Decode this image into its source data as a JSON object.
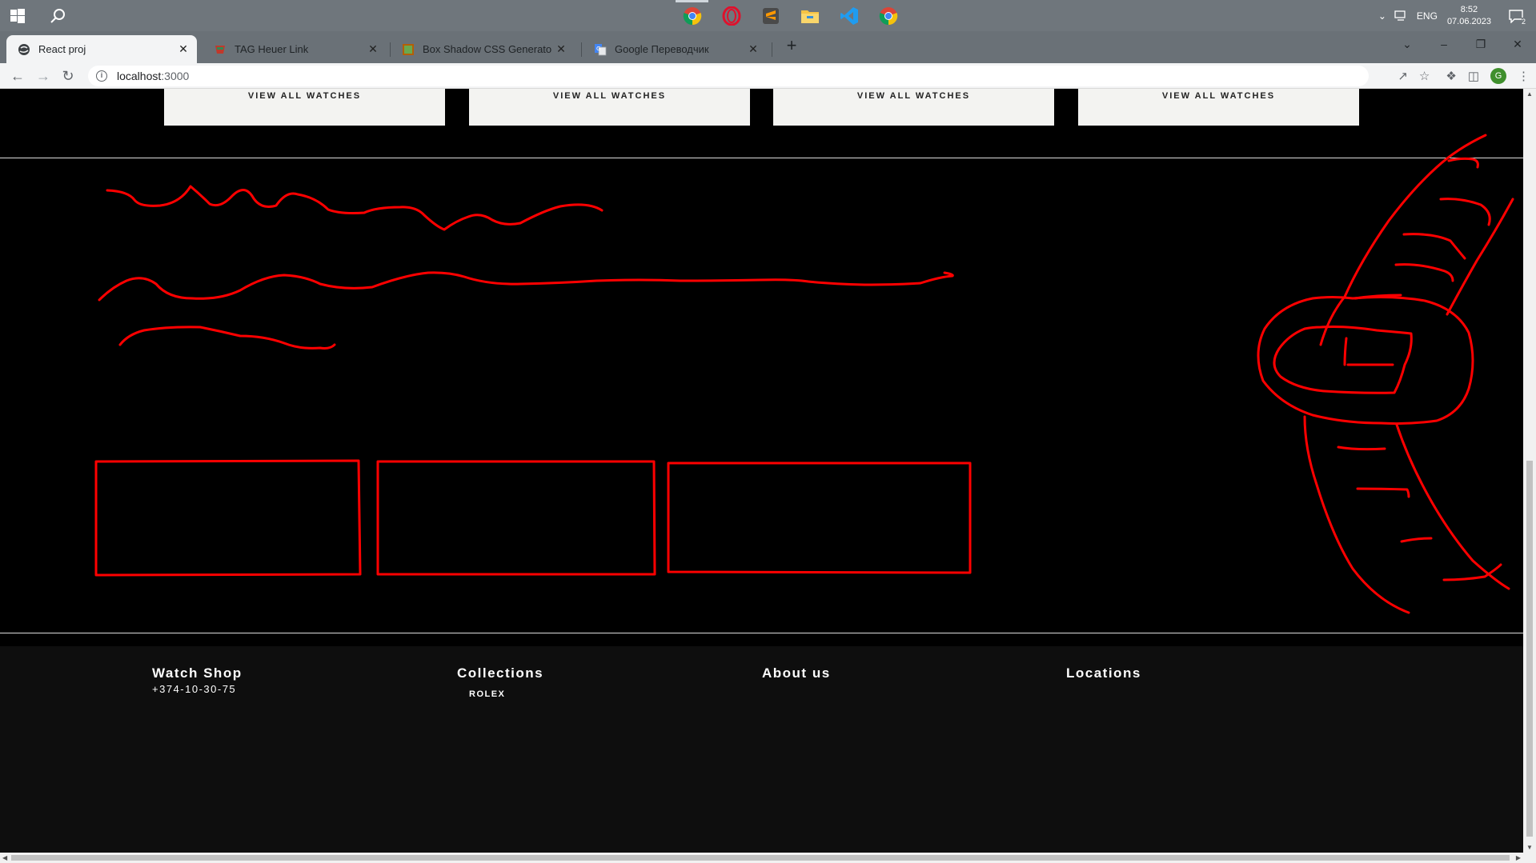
{
  "taskbar": {
    "apps": [
      "chrome-icon",
      "opera-icon",
      "sublime-text-icon",
      "file-explorer-icon",
      "vscode-icon",
      "chrome-icon"
    ],
    "language": "ENG",
    "time": "8:52",
    "date": "07.06.2023",
    "notifications": "2"
  },
  "browser": {
    "tabs": [
      {
        "title": "React proj",
        "active": true
      },
      {
        "title": "TAG Heuer Link",
        "active": false
      },
      {
        "title": "Box Shadow CSS Generator",
        "active": false
      },
      {
        "title": "Google Переводчик",
        "active": false
      }
    ],
    "new_tab": "+",
    "url_host": "localhost",
    "url_port": ":3000"
  },
  "page": {
    "cards": [
      {
        "label": "VIEW ALL WATCHES"
      },
      {
        "label": "VIEW ALL WATCHES"
      },
      {
        "label": "VIEW ALL WATCHES"
      },
      {
        "label": "VIEW ALL WATCHES"
      }
    ],
    "sketch_color": "#ff0000",
    "footer": {
      "brand": "Watch Shop",
      "phone": "+374-10-30-75",
      "collections": "Collections",
      "collections_first": "ROLEX",
      "about": "About us",
      "locations": "Locations"
    }
  }
}
